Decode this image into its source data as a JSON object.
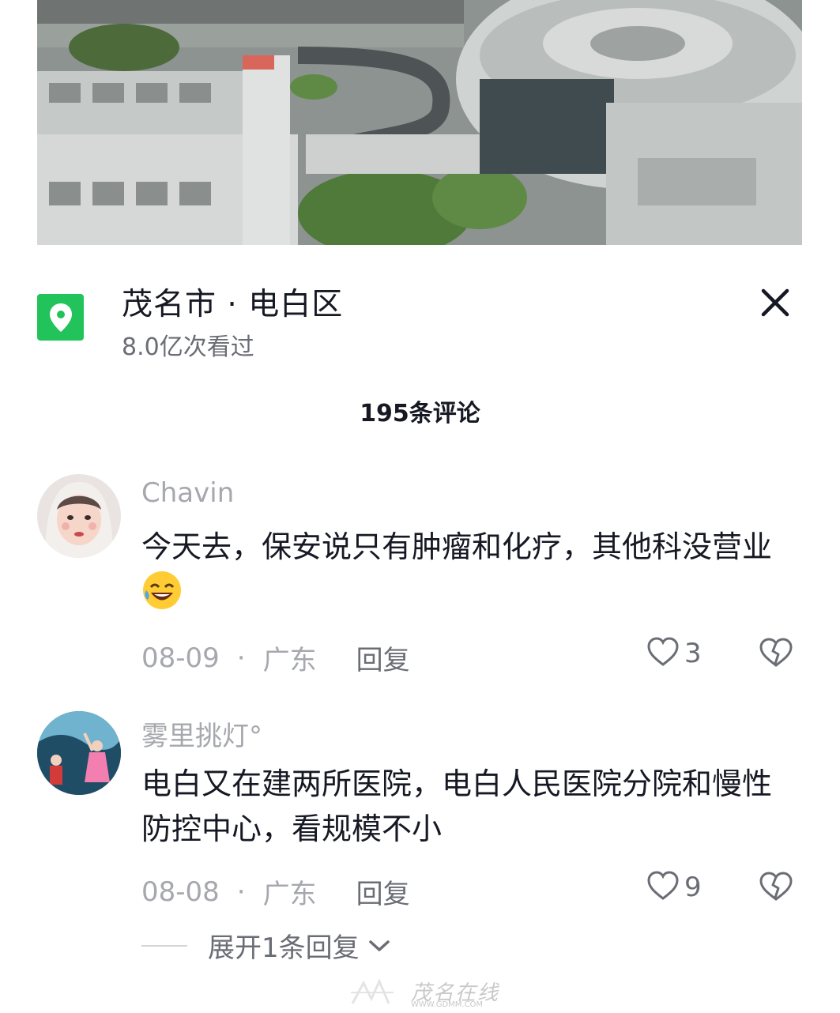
{
  "location": {
    "title": "茂名市 · 电白区",
    "views": "8.0亿次看过",
    "icon": "map-pin-icon",
    "accent": "#22c35a"
  },
  "comment_count": "195条评论",
  "comments": [
    {
      "username": "Chavin",
      "content": "今天去，保安说只有肿瘤和化疗，其他科没营业",
      "emoji": "rolling-laughing-emoji",
      "date": "08-09",
      "separator": "·",
      "region": "广东",
      "reply_label": "回复",
      "likes": "3"
    },
    {
      "username": "雾里挑灯°",
      "content": "电白又在建两所医院，电白人民医院分院和慢性防控中心，看规模不小",
      "date": "08-08",
      "separator": "·",
      "region": "广东",
      "reply_label": "回复",
      "likes": "9"
    }
  ],
  "expand_replies": "展开1条回复",
  "watermark": {
    "text": "茂名在线",
    "url": "WWW.GDMM.COM"
  }
}
